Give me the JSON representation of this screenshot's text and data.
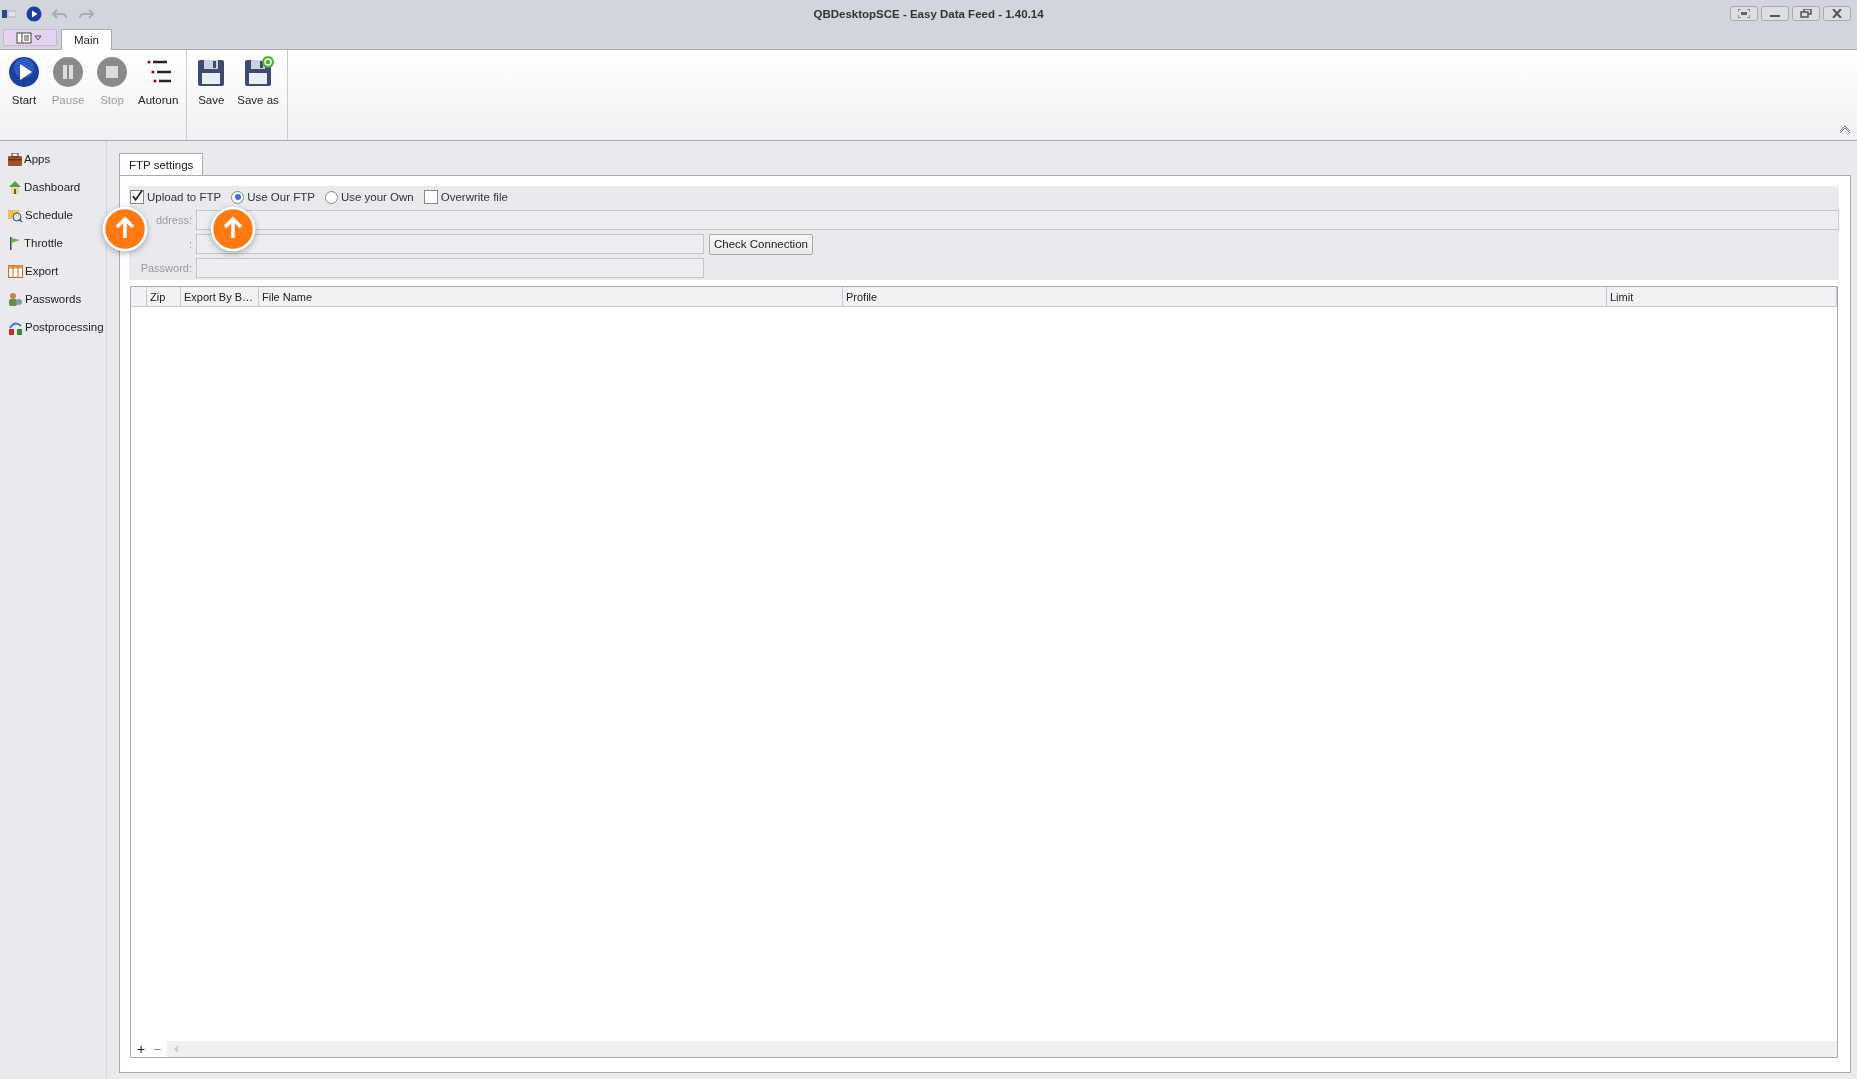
{
  "window": {
    "title": "QBDesktopSCE - Easy Data Feed - 1.40.14"
  },
  "ribbon": {
    "tabs": [
      {
        "label": "Main",
        "selected": true
      }
    ],
    "groups": [
      {
        "buttons": [
          {
            "label": "Start",
            "kind": "start",
            "disabled": false
          },
          {
            "label": "Pause",
            "kind": "pause",
            "disabled": true
          },
          {
            "label": "Stop",
            "kind": "stop",
            "disabled": true
          },
          {
            "label": "Autorun",
            "kind": "autorun",
            "disabled": false
          }
        ]
      },
      {
        "buttons": [
          {
            "label": "Save",
            "kind": "save",
            "disabled": false
          },
          {
            "label": "Save as",
            "kind": "saveas",
            "disabled": false
          }
        ]
      }
    ]
  },
  "sidebar": {
    "items": [
      {
        "label": "Apps",
        "kind": "apps"
      },
      {
        "label": "Dashboard",
        "kind": "dashboard"
      },
      {
        "label": "Schedule",
        "kind": "schedule"
      },
      {
        "label": "Throttle",
        "kind": "throttle"
      },
      {
        "label": "Export",
        "kind": "export"
      },
      {
        "label": "Passwords",
        "kind": "passwords"
      },
      {
        "label": "Postprocessing",
        "kind": "postprocessing"
      }
    ]
  },
  "panel_tabs": [
    {
      "label": "FTP settings",
      "selected": true
    }
  ],
  "options": [
    {
      "kind": "checkbox",
      "label": "Upload to FTP",
      "checked": true
    },
    {
      "kind": "radio",
      "label": "Use Our FTP",
      "selected": true
    },
    {
      "kind": "radio",
      "label": "Use your Own",
      "selected": false
    },
    {
      "kind": "checkbox",
      "label": "Overwrite file",
      "checked": false
    }
  ],
  "fields": [
    {
      "label": "ddress:",
      "disabled": true,
      "wide": true
    },
    {
      "label": ":",
      "disabled": true,
      "wide": false
    },
    {
      "label": "Password:",
      "disabled": true,
      "wide": false
    }
  ],
  "check_button": "Check Connection",
  "table": {
    "columns": [
      "Zip",
      "Export By B…",
      "File Name",
      "Profile",
      "Limit"
    ]
  },
  "navigator": {
    "buttons": [
      "+",
      "−"
    ]
  }
}
